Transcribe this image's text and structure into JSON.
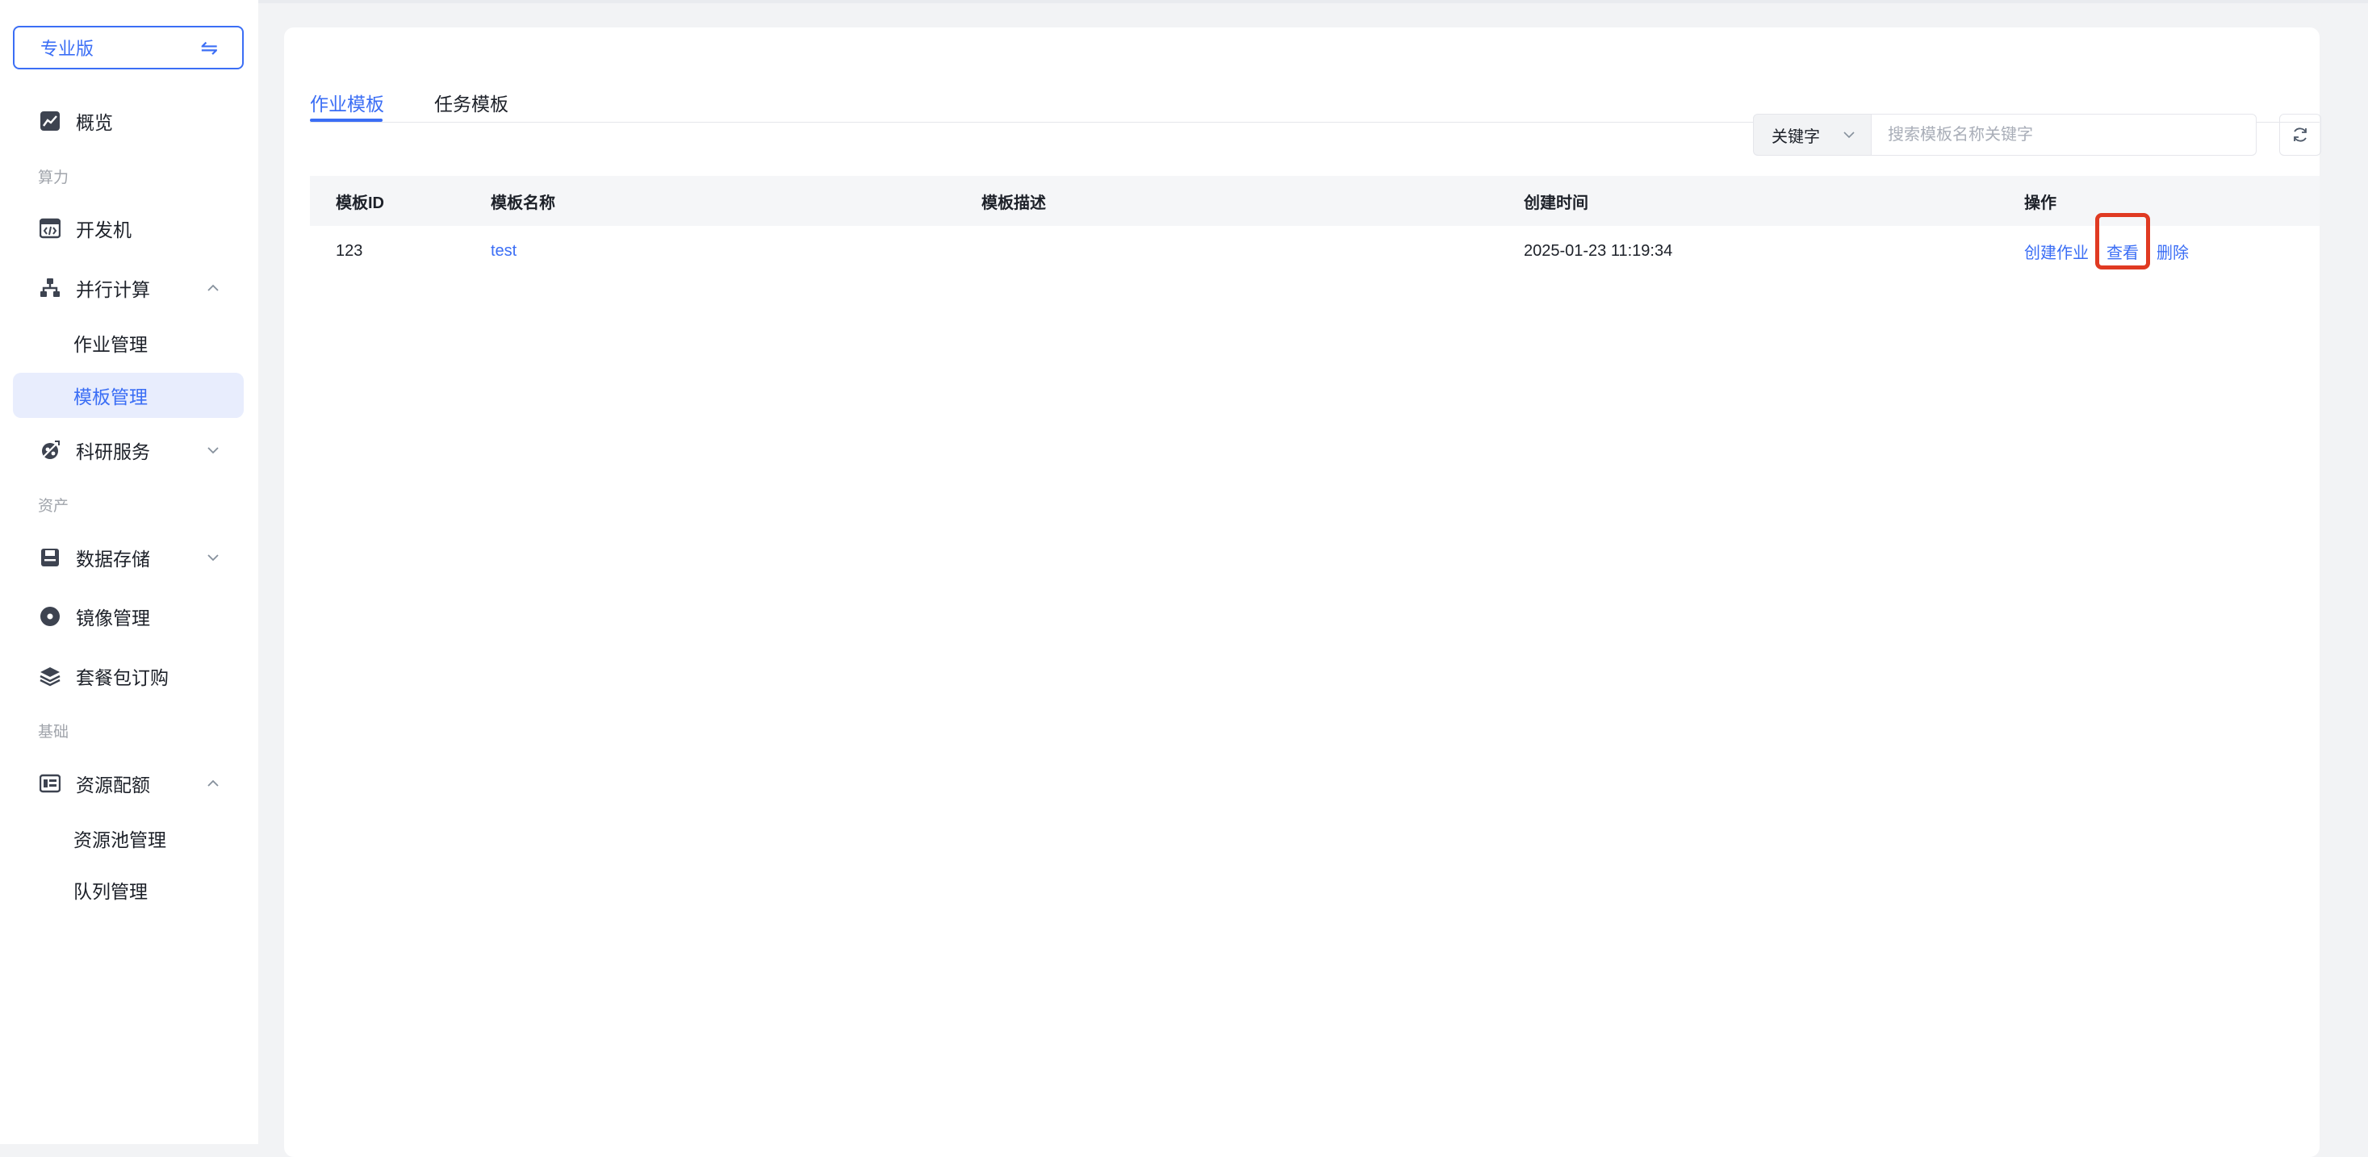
{
  "sidebar": {
    "edition_label": "专业版",
    "edition_switch_icon": "swap-arrows-icon",
    "overview": "概览",
    "group_compute": "算力",
    "dev_machine": "开发机",
    "parallel": "并行计算",
    "job_management": "作业管理",
    "template_management": "模板管理",
    "research": "科研服务",
    "group_assets": "资产",
    "storage": "数据存储",
    "image_management": "镜像管理",
    "package_purchase": "套餐包订购",
    "group_basic": "基础",
    "quota": "资源配额",
    "pool_management": "资源池管理",
    "queue_management": "队列管理"
  },
  "tabs": [
    "作业模板",
    "任务模板"
  ],
  "search": {
    "select_value": "关键字",
    "placeholder": "搜索模板名称关键字"
  },
  "table": {
    "columns": [
      "模板ID",
      "模板名称",
      "模板描述",
      "创建时间",
      "操作"
    ],
    "rows": [
      {
        "id": "123",
        "name": "test",
        "description": "",
        "created": "2025-01-23 11:19:34",
        "actions": [
          "创建作业",
          "查看",
          "删除"
        ]
      }
    ]
  },
  "colors": {
    "accent": "#3b6ef5",
    "highlight": "#e03a22",
    "active_bg": "#e8edfd"
  }
}
